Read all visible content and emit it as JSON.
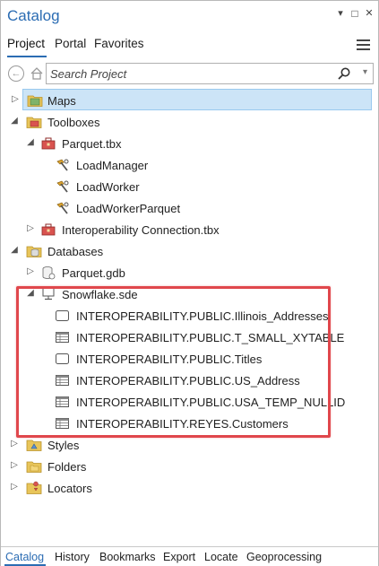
{
  "window": {
    "title": "Catalog",
    "dropdown_glyph": "▾",
    "maximize_glyph": "□",
    "close_glyph": "✕"
  },
  "top_tabs": [
    "Project",
    "Portal",
    "Favorites"
  ],
  "search": {
    "placeholder": "Search Project",
    "back_glyph": "←",
    "dropdown_glyph": "▾"
  },
  "tree": {
    "maps": "Maps",
    "toolboxes": "Toolboxes",
    "parquet_tbx": "Parquet.tbx",
    "load_manager": "LoadManager",
    "load_worker": "LoadWorker",
    "load_worker_parquet": "LoadWorkerParquet",
    "interop_tbx": "Interoperability Connection.tbx",
    "databases": "Databases",
    "parquet_gdb": "Parquet.gdb",
    "snowflake_sde": "Snowflake.sde",
    "tables": [
      {
        "label": "INTEROPERABILITY.PUBLIC.Illinois_Addresses",
        "icon": "feature-class-icon"
      },
      {
        "label": "INTEROPERABILITY.PUBLIC.T_SMALL_XYTABLE",
        "icon": "table-icon"
      },
      {
        "label": "INTEROPERABILITY.PUBLIC.Titles",
        "icon": "feature-class-icon"
      },
      {
        "label": "INTEROPERABILITY.PUBLIC.US_Address",
        "icon": "table-icon"
      },
      {
        "label": "INTEROPERABILITY.PUBLIC.USA_TEMP_NULLID",
        "icon": "table-icon"
      },
      {
        "label": "INTEROPERABILITY.REYES.Customers",
        "icon": "table-icon"
      }
    ],
    "styles": "Styles",
    "folders": "Folders",
    "locators": "Locators",
    "caret_collapsed": "▷",
    "caret_expanded": "◢"
  },
  "bottom_tabs": [
    "Catalog",
    "History",
    "Bookmarks",
    "Export",
    "Locate",
    "Geoprocessing"
  ],
  "colors": {
    "accent": "#2b6cb3",
    "selection": "#cce4f7",
    "highlight_box": "#e0474c"
  }
}
